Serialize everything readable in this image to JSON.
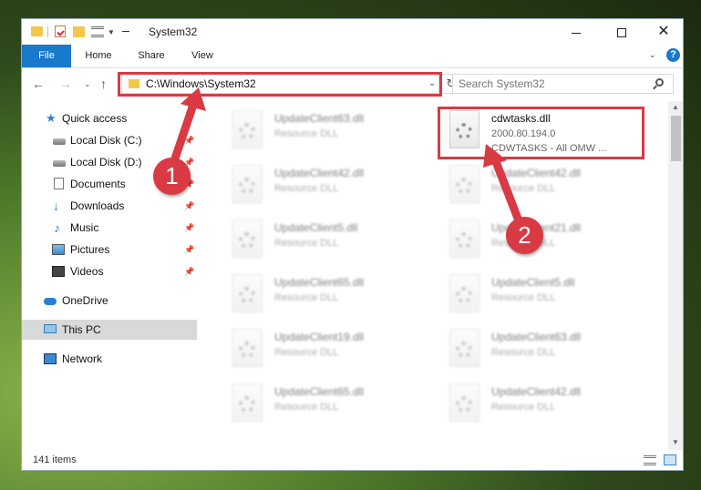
{
  "window": {
    "title": "System32",
    "minimize_label": "",
    "maximize_label": "",
    "close_label": "✕"
  },
  "ribbon": {
    "tabs": [
      "File",
      "Home",
      "Share",
      "View"
    ],
    "help_label": "?"
  },
  "address_bar": {
    "path": "C:\\Windows\\System32",
    "refresh_label": "↻"
  },
  "search": {
    "placeholder": "Search System32"
  },
  "sidebar": {
    "items": [
      {
        "label": "Quick access",
        "icon": "star-icon",
        "pinned": false
      },
      {
        "label": "Local Disk (C:)",
        "icon": "disk-icon",
        "pinned": true
      },
      {
        "label": "Local Disk (D:)",
        "icon": "disk-icon",
        "pinned": true
      },
      {
        "label": "Documents",
        "icon": "document-icon",
        "pinned": true
      },
      {
        "label": "Downloads",
        "icon": "download-icon",
        "pinned": true
      },
      {
        "label": "Music",
        "icon": "music-icon",
        "pinned": true
      },
      {
        "label": "Pictures",
        "icon": "pictures-icon",
        "pinned": true
      },
      {
        "label": "Videos",
        "icon": "videos-icon",
        "pinned": true
      },
      {
        "label": "OneDrive",
        "icon": "cloud-icon",
        "pinned": false
      },
      {
        "label": "This PC",
        "icon": "computer-icon",
        "pinned": false,
        "selected": true
      },
      {
        "label": "Network",
        "icon": "network-icon",
        "pinned": false
      }
    ]
  },
  "files": {
    "left": [
      {
        "name": "UpdateClient63.dll",
        "desc": "Resource DLL"
      },
      {
        "name": "UpdateClient42.dll",
        "desc": "Resource DLL"
      },
      {
        "name": "UpdateClient5.dll",
        "desc": "Resource DLL"
      },
      {
        "name": "UpdateClient65.dll",
        "desc": "Resource DLL"
      },
      {
        "name": "UpdateClient19.dll",
        "desc": "Resource DLL"
      },
      {
        "name": "UpdateClient65.dll",
        "desc": "Resource DLL"
      }
    ],
    "right": [
      {
        "name": "cdwtasks.dll",
        "desc": "2000.80.194.0",
        "company": "CDWTASKS - All OMW ..."
      },
      {
        "name": "UpdateClient42.dll",
        "desc": "Resource DLL"
      },
      {
        "name": "UpdateClient21.dll",
        "desc": "Resource DLL"
      },
      {
        "name": "UpdateClient5.dll",
        "desc": "Resource DLL"
      },
      {
        "name": "UpdateClient63.dll",
        "desc": "Resource DLL"
      },
      {
        "name": "UpdateClient42.dll",
        "desc": "Resource DLL"
      }
    ]
  },
  "status": {
    "item_count": "141 items"
  },
  "annotations": {
    "step1": "1",
    "step2": "2",
    "color": "#d93a44"
  },
  "colors": {
    "accent": "#1979ca",
    "highlight": "#d93a44"
  }
}
